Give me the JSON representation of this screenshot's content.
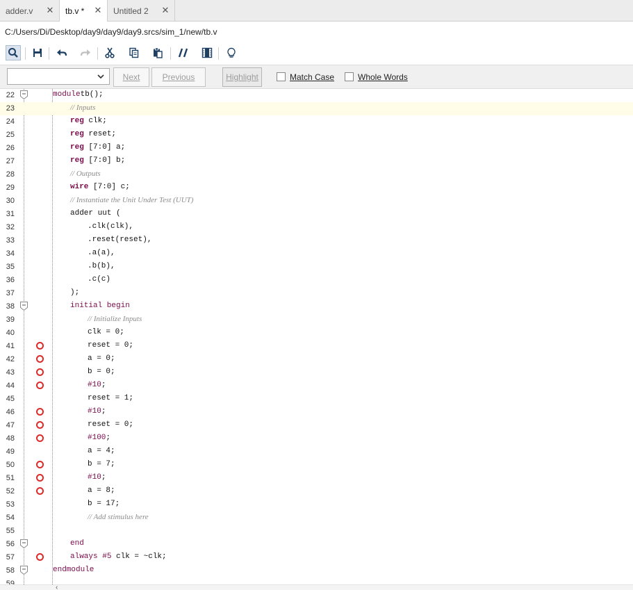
{
  "tabs": [
    {
      "label": "adder.v"
    },
    {
      "label": "tb.v *"
    },
    {
      "label": "Untitled 2"
    }
  ],
  "file_path": "C:/Users/Di/Desktop/day9/day9/day9.srcs/sim_1/new/tb.v",
  "toolbar": {
    "icons": [
      "search-icon",
      "save-icon",
      "undo-icon",
      "redo-icon",
      "cut-icon",
      "copy-icon",
      "paste-icon",
      "comment-icon",
      "block-select-icon",
      "lightbulb-icon"
    ]
  },
  "find": {
    "combo_value": "",
    "next_label": "Next",
    "previous_label": "Previous",
    "highlight_label": "Highlight",
    "match_case_label": "Match Case",
    "whole_words_label": "Whole Words"
  },
  "colors": {
    "keyword": "#7a0a4a",
    "breakpoint": "#dd2a2a",
    "current_line": "#fffde8"
  },
  "code_lines": [
    {
      "n": "22",
      "indent": 0,
      "fold": true,
      "bp": false,
      "hl": false,
      "segs": [
        [
          "kw",
          "module"
        ],
        [
          "",
          "tb();"
        ]
      ]
    },
    {
      "n": "23",
      "indent": 1,
      "fold": false,
      "bp": false,
      "hl": true,
      "segs": [
        [
          "cm",
          "// Inputs"
        ]
      ]
    },
    {
      "n": "24",
      "indent": 1,
      "fold": false,
      "bp": false,
      "hl": false,
      "segs": [
        [
          "kwb",
          "reg"
        ],
        [
          "",
          " clk;"
        ]
      ]
    },
    {
      "n": "25",
      "indent": 1,
      "fold": false,
      "bp": false,
      "hl": false,
      "segs": [
        [
          "kwb",
          "reg"
        ],
        [
          "",
          " reset;"
        ]
      ]
    },
    {
      "n": "26",
      "indent": 1,
      "fold": false,
      "bp": false,
      "hl": false,
      "segs": [
        [
          "kwb",
          "reg"
        ],
        [
          "",
          " [7:0] a;"
        ]
      ]
    },
    {
      "n": "27",
      "indent": 1,
      "fold": false,
      "bp": false,
      "hl": false,
      "segs": [
        [
          "kwb",
          "reg"
        ],
        [
          "",
          " [7:0] b;"
        ]
      ]
    },
    {
      "n": "28",
      "indent": 1,
      "fold": false,
      "bp": false,
      "hl": false,
      "segs": [
        [
          "cm",
          "// Outputs"
        ]
      ]
    },
    {
      "n": "29",
      "indent": 1,
      "fold": false,
      "bp": false,
      "hl": false,
      "segs": [
        [
          "kwb",
          "wire"
        ],
        [
          "",
          " [7:0] c;"
        ]
      ]
    },
    {
      "n": "30",
      "indent": 1,
      "fold": false,
      "bp": false,
      "hl": false,
      "segs": [
        [
          "cm",
          "// Instantiate the Unit Under Test (UUT)"
        ]
      ]
    },
    {
      "n": "31",
      "indent": 1,
      "fold": false,
      "bp": false,
      "hl": false,
      "segs": [
        [
          "",
          "adder uut ("
        ]
      ]
    },
    {
      "n": "32",
      "indent": 2,
      "fold": false,
      "bp": false,
      "hl": false,
      "segs": [
        [
          "",
          ".clk(clk),"
        ]
      ]
    },
    {
      "n": "33",
      "indent": 2,
      "fold": false,
      "bp": false,
      "hl": false,
      "segs": [
        [
          "",
          ".reset(reset),"
        ]
      ]
    },
    {
      "n": "34",
      "indent": 2,
      "fold": false,
      "bp": false,
      "hl": false,
      "segs": [
        [
          "",
          ".a(a),"
        ]
      ]
    },
    {
      "n": "35",
      "indent": 2,
      "fold": false,
      "bp": false,
      "hl": false,
      "segs": [
        [
          "",
          ".b(b),"
        ]
      ]
    },
    {
      "n": "36",
      "indent": 2,
      "fold": false,
      "bp": false,
      "hl": false,
      "segs": [
        [
          "",
          ".c(c)"
        ]
      ]
    },
    {
      "n": "37",
      "indent": 1,
      "fold": false,
      "bp": false,
      "hl": false,
      "segs": [
        [
          "",
          ");"
        ]
      ]
    },
    {
      "n": "38",
      "indent": 1,
      "fold": true,
      "bp": false,
      "hl": false,
      "segs": [
        [
          "kw",
          "initial begin"
        ]
      ]
    },
    {
      "n": "39",
      "indent": 2,
      "fold": false,
      "bp": false,
      "hl": false,
      "segs": [
        [
          "cm",
          "// Initialize Inputs"
        ]
      ]
    },
    {
      "n": "40",
      "indent": 2,
      "fold": false,
      "bp": false,
      "hl": false,
      "segs": [
        [
          "",
          "clk = 0;"
        ]
      ]
    },
    {
      "n": "41",
      "indent": 2,
      "fold": false,
      "bp": true,
      "hl": false,
      "segs": [
        [
          "",
          "reset = 0;"
        ]
      ]
    },
    {
      "n": "42",
      "indent": 2,
      "fold": false,
      "bp": true,
      "hl": false,
      "segs": [
        [
          "",
          "a = 0;"
        ]
      ]
    },
    {
      "n": "43",
      "indent": 2,
      "fold": false,
      "bp": true,
      "hl": false,
      "segs": [
        [
          "",
          "b = 0;"
        ]
      ]
    },
    {
      "n": "44",
      "indent": 2,
      "fold": false,
      "bp": true,
      "hl": false,
      "segs": [
        [
          "kw",
          "#10"
        ],
        [
          "",
          ";"
        ]
      ]
    },
    {
      "n": "45",
      "indent": 2,
      "fold": false,
      "bp": false,
      "hl": false,
      "segs": [
        [
          "",
          "reset = 1;"
        ]
      ]
    },
    {
      "n": "46",
      "indent": 2,
      "fold": false,
      "bp": true,
      "hl": false,
      "segs": [
        [
          "kw",
          "#10"
        ],
        [
          "",
          ";"
        ]
      ]
    },
    {
      "n": "47",
      "indent": 2,
      "fold": false,
      "bp": true,
      "hl": false,
      "segs": [
        [
          "",
          "reset = 0;"
        ]
      ]
    },
    {
      "n": "48",
      "indent": 2,
      "fold": false,
      "bp": true,
      "hl": false,
      "segs": [
        [
          "kw",
          "#100"
        ],
        [
          "",
          ";"
        ]
      ]
    },
    {
      "n": "49",
      "indent": 2,
      "fold": false,
      "bp": false,
      "hl": false,
      "segs": [
        [
          "",
          "a = 4;"
        ]
      ]
    },
    {
      "n": "50",
      "indent": 2,
      "fold": false,
      "bp": true,
      "hl": false,
      "segs": [
        [
          "",
          "b = 7;"
        ]
      ]
    },
    {
      "n": "51",
      "indent": 2,
      "fold": false,
      "bp": true,
      "hl": false,
      "segs": [
        [
          "kw",
          "#10"
        ],
        [
          "",
          ";"
        ]
      ]
    },
    {
      "n": "52",
      "indent": 2,
      "fold": false,
      "bp": true,
      "hl": false,
      "segs": [
        [
          "",
          "a = 8;"
        ]
      ]
    },
    {
      "n": "53",
      "indent": 2,
      "fold": false,
      "bp": false,
      "hl": false,
      "segs": [
        [
          "",
          "b = 17;"
        ]
      ]
    },
    {
      "n": "54",
      "indent": 2,
      "fold": false,
      "bp": false,
      "hl": false,
      "segs": [
        [
          "cm",
          "// Add stimulus here"
        ]
      ]
    },
    {
      "n": "55",
      "indent": 1,
      "fold": false,
      "bp": false,
      "hl": false,
      "segs": []
    },
    {
      "n": "56",
      "indent": 1,
      "fold": true,
      "bp": false,
      "hl": false,
      "segs": [
        [
          "kw",
          "end"
        ]
      ]
    },
    {
      "n": "57",
      "indent": 1,
      "fold": false,
      "bp": true,
      "hl": false,
      "segs": [
        [
          "kw",
          "always"
        ],
        [
          "",
          " "
        ],
        [
          "kw",
          "#5"
        ],
        [
          "",
          " clk = ~clk;"
        ]
      ]
    },
    {
      "n": "58",
      "indent": 0,
      "fold": true,
      "bp": false,
      "hl": false,
      "segs": [
        [
          "kw",
          "endmodule"
        ]
      ]
    },
    {
      "n": "59",
      "indent": 0,
      "fold": false,
      "bp": false,
      "hl": false,
      "segs": []
    }
  ]
}
